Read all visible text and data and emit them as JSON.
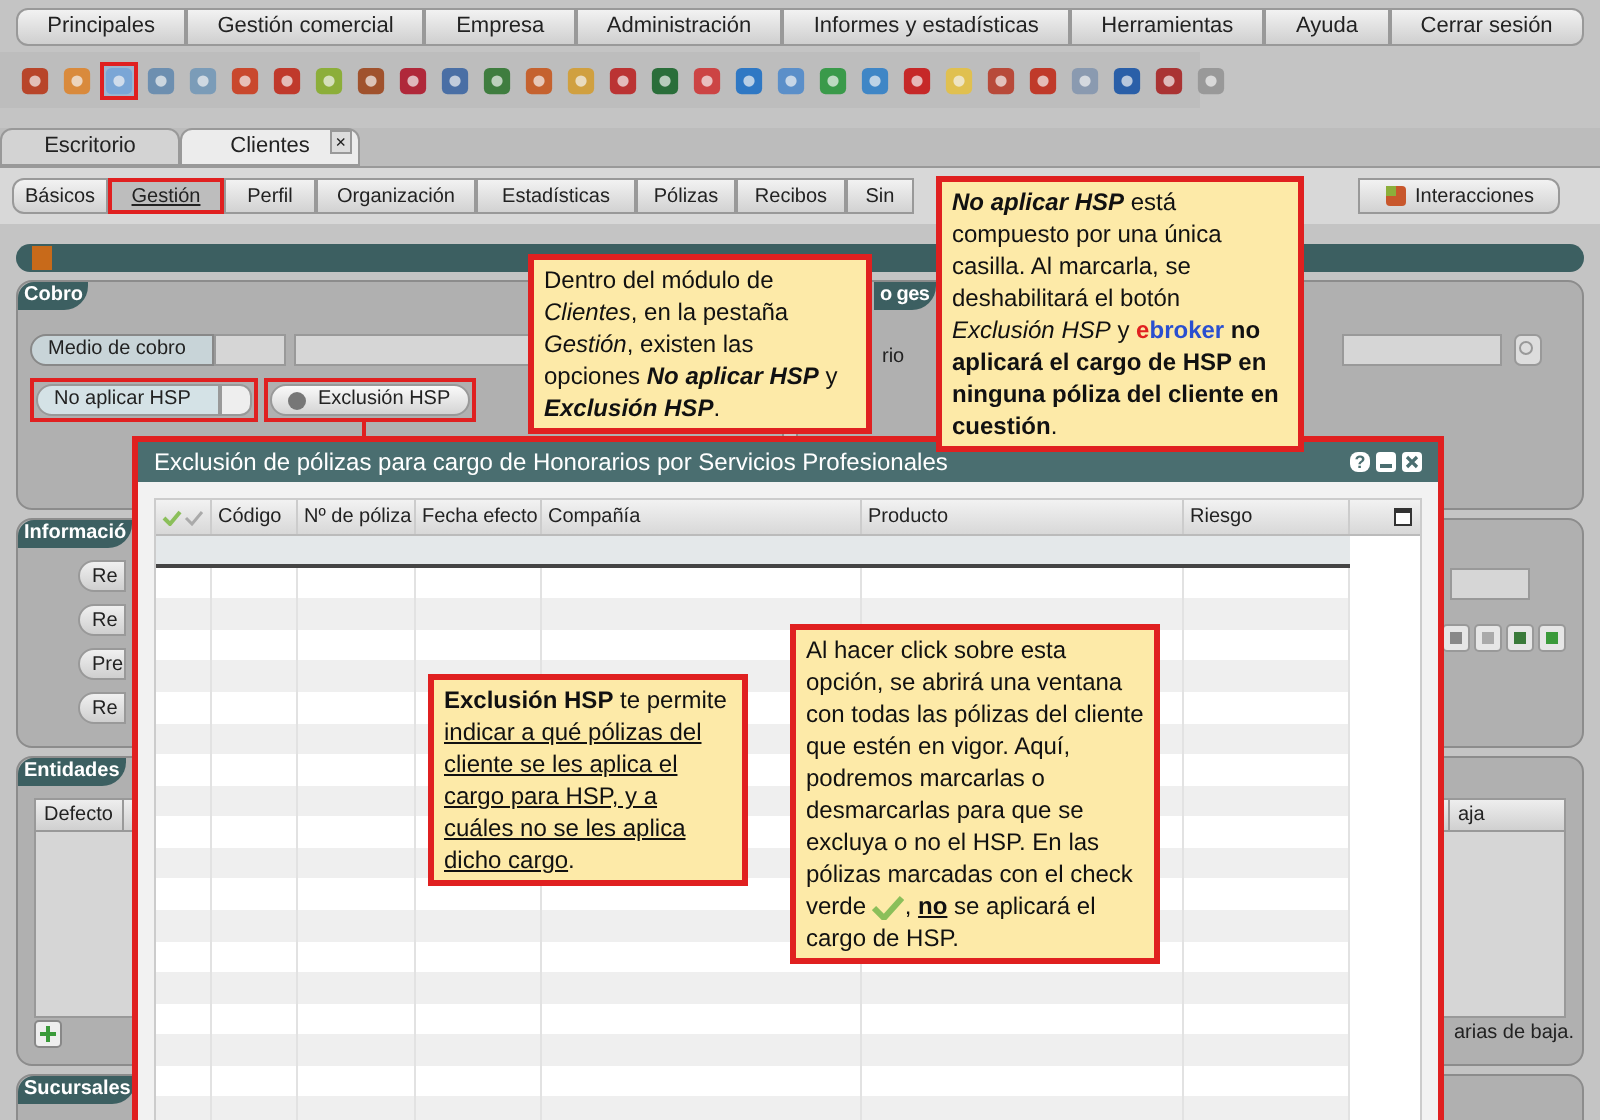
{
  "menu": [
    {
      "label": "Principales"
    },
    {
      "label": "Gestión comercial"
    },
    {
      "label": "Empresa"
    },
    {
      "label": "Administración"
    },
    {
      "label": "Informes y estadísticas"
    },
    {
      "label": "Herramientas"
    },
    {
      "label": "Ayuda"
    },
    {
      "label": "Cerrar sesión"
    }
  ],
  "toolbar": [
    {
      "selected": false
    },
    {
      "selected": false
    },
    {
      "selected": true
    },
    {
      "selected": false
    },
    {
      "selected": false
    },
    {
      "selected": false
    },
    {
      "selected": false
    },
    {
      "selected": false
    },
    {
      "selected": false
    },
    {
      "selected": false
    },
    {
      "selected": false
    },
    {
      "selected": false
    },
    {
      "selected": false
    },
    {
      "selected": false
    },
    {
      "selected": false
    },
    {
      "selected": false
    },
    {
      "selected": false
    },
    {
      "selected": false
    },
    {
      "selected": false
    },
    {
      "selected": false
    },
    {
      "selected": false
    },
    {
      "selected": false
    },
    {
      "selected": false
    },
    {
      "selected": false
    },
    {
      "selected": false
    },
    {
      "selected": false
    },
    {
      "selected": false
    },
    {
      "selected": false
    },
    {
      "selected": false
    }
  ],
  "tabs": [
    {
      "label": "Escritorio",
      "selected": false,
      "closable": false
    },
    {
      "label": "Clientes",
      "selected": true,
      "closable": true
    }
  ],
  "close_glyph": "×",
  "subtabs": [
    {
      "label": "Básicos",
      "selected": false
    },
    {
      "label": "Gestión",
      "selected": true
    },
    {
      "label": "Perfil",
      "selected": false
    },
    {
      "label": "Organización",
      "selected": false
    },
    {
      "label": "Estadísticas",
      "selected": false
    },
    {
      "label": "Pólizas",
      "selected": false
    },
    {
      "label": "Recibos",
      "selected": false
    },
    {
      "label": "Sin",
      "selected": false
    }
  ],
  "interacciones": "Interacciones",
  "cobro": {
    "title": "Cobro",
    "medio_label": "Medio de cobro",
    "hsp_label": "No aplicar HSP",
    "hsp_checked": false,
    "exclusion_button": "Exclusión HSP"
  },
  "right_panel": {
    "title": "o ges",
    "field_label": "rio"
  },
  "informacion": {
    "title": "Informació",
    "buttons": [
      "Re",
      "Re",
      "Pre",
      "Re"
    ]
  },
  "entidades": {
    "title": "Entidades",
    "column_1": "Defecto",
    "column_2": "aja",
    "footer": "arias de baja."
  },
  "sucursales": {
    "title": "Sucursales"
  },
  "modal": {
    "title": "Exclusión de pólizas para cargo de Honorarios por Servicios Profesionales",
    "help": "?",
    "columns": [
      "Código",
      "Nº de póliza",
      "Fecha efecto",
      "Compañía",
      "Producto",
      "Riesgo"
    ]
  },
  "callouts": [
    {
      "segments": [
        {
          "kind": "plain",
          "text": "Dentro del módulo de "
        },
        {
          "kind": "italic",
          "text": "Clientes"
        },
        {
          "kind": "plain",
          "text": ", en la pestaña "
        },
        {
          "kind": "italic",
          "text": "Gestión"
        },
        {
          "kind": "plain",
          "text": ", existen las opciones "
        },
        {
          "kind": "bolditalic",
          "text": "No aplicar HSP"
        },
        {
          "kind": "plain",
          "text": " y "
        },
        {
          "kind": "bolditalic",
          "text": "Exclusión HSP"
        },
        {
          "kind": "plain",
          "text": "."
        }
      ]
    },
    {
      "segments": [
        {
          "kind": "bolditalic",
          "text": "No aplicar HSP"
        },
        {
          "kind": "plain",
          "text": " está compuesto por una única casilla. Al marcarla, se deshabilitará el botón "
        },
        {
          "kind": "italic",
          "text": "Exclusión HSP"
        },
        {
          "kind": "plain",
          "text": " y "
        },
        {
          "kind": "brand_a",
          "text": "e"
        },
        {
          "kind": "brand_b",
          "text": "broker"
        },
        {
          "kind": "bold",
          "text": " no aplicará el cargo de HSP en ninguna póliza del cliente en cuestión"
        },
        {
          "kind": "plain",
          "text": "."
        }
      ]
    },
    {
      "segments": [
        {
          "kind": "bold",
          "text": "Exclusión HSP"
        },
        {
          "kind": "plain",
          "text": " te permite "
        },
        {
          "kind": "underline",
          "text": "indicar a qué pólizas del cliente se les aplica el cargo para HSP, y a cuáles no se les aplica dicho cargo"
        },
        {
          "kind": "plain",
          "text": "."
        }
      ]
    },
    {
      "segments": [
        {
          "kind": "plain",
          "text": "Al hacer click sobre esta opción, se abrirá una ventana con todas las pólizas del cliente que estén en vigor. Aquí, podremos marcarlas o desmarcarlas para que se excluya o no el HSP. En las pólizas marcadas con el check verde "
        },
        {
          "kind": "check_icon"
        },
        {
          "kind": "plain",
          "text": ", "
        },
        {
          "kind": "boldunderline",
          "text": "no"
        },
        {
          "kind": "plain",
          "text": " se aplicará el cargo de HSP."
        }
      ]
    }
  ]
}
